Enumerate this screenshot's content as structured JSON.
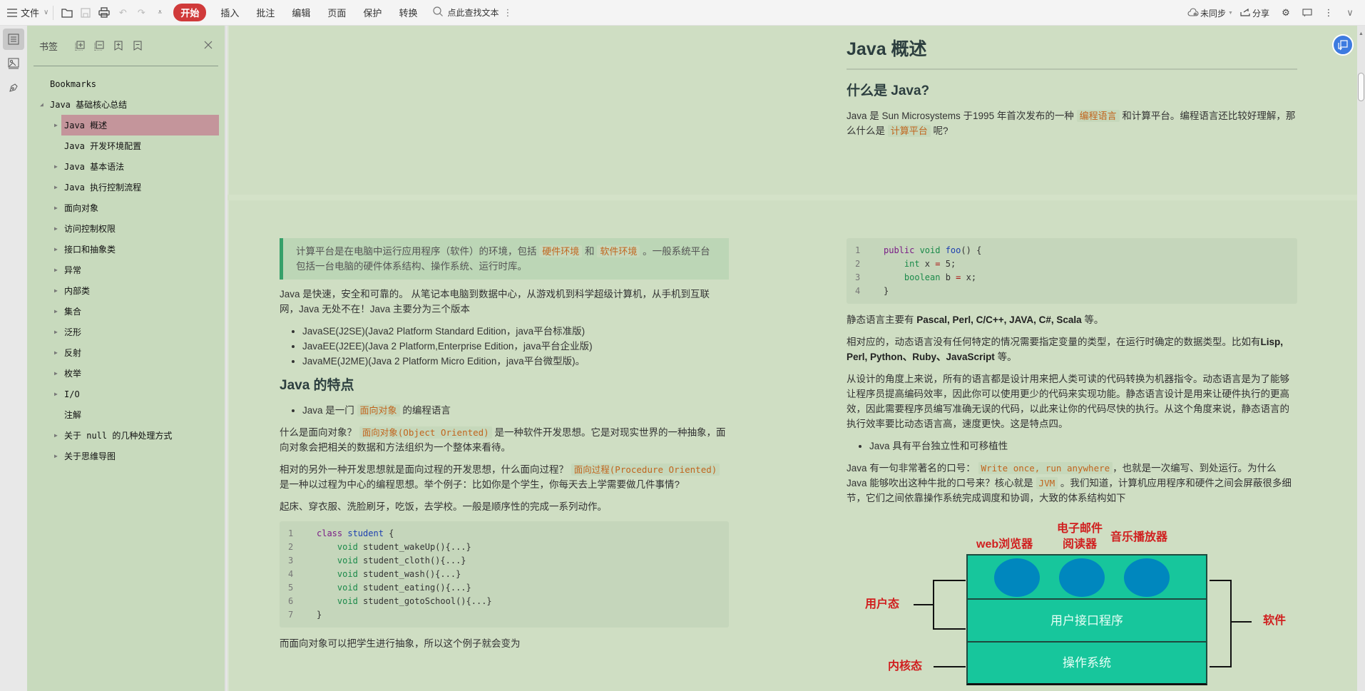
{
  "toolbar": {
    "menu_label": "文件",
    "tabs": [
      "开始",
      "插入",
      "批注",
      "编辑",
      "页面",
      "保护",
      "转换"
    ],
    "active_tab": "开始",
    "search_placeholder": "点此查找文本",
    "sync_label": "未同步",
    "share_label": "分享",
    "accent": "#d03a3a"
  },
  "sidebar": {
    "title": "书签",
    "items": [
      {
        "label": "Bookmarks",
        "level": 0,
        "arrow": "none"
      },
      {
        "label": "Java 基础核心总结",
        "level": 0,
        "arrow": "expanded"
      },
      {
        "label": "Java 概述",
        "level": 1,
        "arrow": "collapsed",
        "selected": true
      },
      {
        "label": "Java 开发环境配置",
        "level": 1,
        "arrow": "none"
      },
      {
        "label": "Java 基本语法",
        "level": 1,
        "arrow": "collapsed"
      },
      {
        "label": "Java 执行控制流程",
        "level": 1,
        "arrow": "collapsed"
      },
      {
        "label": "面向对象",
        "level": 1,
        "arrow": "collapsed"
      },
      {
        "label": "访问控制权限",
        "level": 1,
        "arrow": "collapsed"
      },
      {
        "label": "接口和抽象类",
        "level": 1,
        "arrow": "collapsed"
      },
      {
        "label": "异常",
        "level": 1,
        "arrow": "collapsed"
      },
      {
        "label": "内部类",
        "level": 1,
        "arrow": "collapsed"
      },
      {
        "label": "集合",
        "level": 1,
        "arrow": "collapsed"
      },
      {
        "label": "泛形",
        "level": 1,
        "arrow": "collapsed"
      },
      {
        "label": "反射",
        "level": 1,
        "arrow": "collapsed"
      },
      {
        "label": "枚举",
        "level": 1,
        "arrow": "collapsed"
      },
      {
        "label": "I/O",
        "level": 1,
        "arrow": "collapsed"
      },
      {
        "label": "注解",
        "level": 1,
        "arrow": "none"
      },
      {
        "label": "关于 null 的几种处理方式",
        "level": 1,
        "arrow": "collapsed"
      },
      {
        "label": "关于思维导图",
        "level": 1,
        "arrow": "collapsed"
      }
    ]
  },
  "doc": {
    "page1": {
      "h1": "Java 概述",
      "h2": "什么是 Java?",
      "p1_a": "Java 是 Sun Microsystems 于1995 年首次发布的一种",
      "p1_code1": "编程语言",
      "p1_b": "和计算平台。编程语言还比较好理解，那么什么是",
      "p1_code2": "计算平台",
      "p1_c": "呢?"
    },
    "left": {
      "quote_a": "计算平台是在电脑中运行应用程序（软件）的环境，包括",
      "quote_code1": "硬件环境",
      "quote_b": "和",
      "quote_code2": "软件环境",
      "quote_c": "。一般系统平台包括一台电脑的硬件体系结构、操作系统、运行时库。",
      "p2": "Java 是快速，安全和可靠的。 从笔记本电脑到数据中心，从游戏机到科学超级计算机，从手机到互联网，Java 无处不在！Java 主要分为三个版本",
      "editions": [
        "JavaSE(J2SE)(Java2 Platform Standard Edition，java平台标准版)",
        "JavaEE(J2EE)(Java 2 Platform,Enterprise Edition，java平台企业版)",
        "JavaME(J2ME)(Java 2 Platform Micro Edition，java平台微型版)。"
      ],
      "h2": "Java 的特点",
      "bullet_a": "Java 是一门",
      "bullet_code": "面向对象",
      "bullet_b": "的编程语言",
      "p3_a": "什么是面向对象？",
      "p3_code": "面向对象(Object Oriented)",
      "p3_b": "是一种软件开发思想。它是对现实世界的一种抽象，面向对象会把相关的数据和方法组织为一个整体来看待。",
      "p4_a": "相对的另外一种开发思想就是面向过程的开发思想，什么面向过程？",
      "p4_code": "面向过程(Procedure Oriented)",
      "p4_b": "是一种以过程为中心的编程思想。举个例子：比如你是个学生，你每天去上学需要做几件事情?",
      "p5": "起床、穿衣服、洗脸刷牙，吃饭，去学校。一般是顺序性的完成一系列动作。",
      "code": [
        {
          "n": "1",
          "kw": "class",
          "fn": " student",
          "rest": " {"
        },
        {
          "n": "2",
          "ty": "    void",
          "rest": " student_wakeUp(){...}"
        },
        {
          "n": "3",
          "ty": "    void",
          "rest": " student_cloth(){...}"
        },
        {
          "n": "4",
          "ty": "    void",
          "rest": " student_wash(){...}"
        },
        {
          "n": "5",
          "ty": "    void",
          "rest": " student_eating(){...}"
        },
        {
          "n": "6",
          "ty": "    void",
          "rest": " student_gotoSchool(){...}"
        },
        {
          "n": "7",
          "rest": "}"
        }
      ],
      "p6": "而面向对象可以把学生进行抽象，所以这个例子就会变为"
    },
    "right": {
      "code": [
        {
          "n": "1",
          "kw": "public",
          "ty": " void",
          "fn": " foo",
          "rest": "() {"
        },
        {
          "n": "2",
          "ty": "    int",
          "rest": " x ",
          "op": "=",
          "rest2": " 5;"
        },
        {
          "n": "3",
          "ty": "    boolean",
          "rest": " b ",
          "op": "=",
          "rest2": " x;"
        },
        {
          "n": "4",
          "rest": "}"
        }
      ],
      "p1_a": "静态语言主要有",
      "p1_bold": "Pascal, Perl, C/C++, JAVA, C#, Scala",
      "p1_b": "等。",
      "p2_a": "相对应的，动态语言没有任何特定的情况需要指定变量的类型，在运行时确定的数据类型。比如有",
      "p2_bold": "Lisp, Perl, Python、Ruby、JavaScript",
      "p2_b": "等。",
      "p3": "从设计的角度上来说，所有的语言都是设计用来把人类可读的代码转换为机器指令。动态语言是为了能够让程序员提高编码效率，因此你可以使用更少的代码来实现功能。静态语言设计是用来让硬件执行的更高效，因此需要程序员编写准确无误的代码，以此来让你的代码尽快的执行。从这个角度来说，静态语言的执行效率要比动态语言高，速度更快。这是特点四。",
      "bullet": "Java 具有平台独立性和可移植性",
      "p4_a": "Java 有一句非常著名的口号：",
      "p4_code1": "Write once, run anywhere",
      "p4_b": "，也就是一次编写、到处运行。为什么 Java 能够吹出这种牛批的口号来？核心就是",
      "p4_code2": "JVM",
      "p4_c": "。我们知道，计算机应用程序和硬件之间会屏蔽很多细节，它们之间依靠操作系统完成调度和协调，大致的体系结构如下"
    },
    "diagram": {
      "apps": [
        "web浏览器",
        "电子邮件\n阅读器",
        "音乐播放器"
      ],
      "layers": [
        "用户接口程序",
        "操作系统"
      ],
      "user_mode": "用户态",
      "kernel_mode": "内核态",
      "software": "软件"
    }
  }
}
